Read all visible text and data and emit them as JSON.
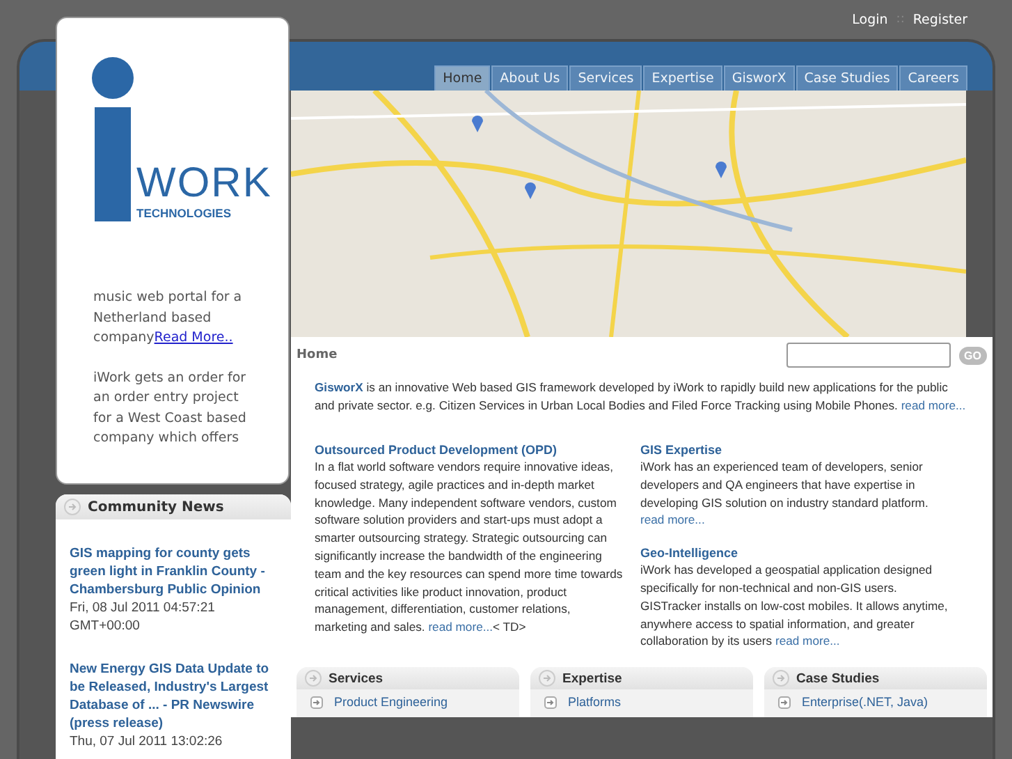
{
  "header_links": [
    {
      "label": "Login"
    },
    {
      "label": "Register"
    }
  ],
  "header_separator": "::",
  "logo": {
    "word": "WORK",
    "tagline": "TECHNOLOGIES"
  },
  "nav_tabs": [
    {
      "label": "Home",
      "selected": true
    },
    {
      "label": "About Us",
      "selected": false
    },
    {
      "label": "Services",
      "selected": false
    },
    {
      "label": "Expertise",
      "selected": false
    },
    {
      "label": "GisworX",
      "selected": false
    },
    {
      "label": "Case Studies",
      "selected": false
    },
    {
      "label": "Careers",
      "selected": false
    }
  ],
  "ticker": [
    {
      "text": "music web portal for a Netherland based company",
      "link": "Read More.."
    },
    {
      "text": "iWork gets an order for an order entry project for a West Coast based company which offers"
    }
  ],
  "community_news": {
    "title": "Community News",
    "items": [
      {
        "title": "GIS mapping for county gets green light in Franklin County - Chambersburg Public Opinion",
        "date": "Fri, 08 Jul 2011 04:57:21 GMT+00:00"
      },
      {
        "title": "New Energy GIS Data Update to be Released, Industry's Largest Database of ... - PR Newswire (press release)",
        "date": "Thu, 07 Jul 2011 13:02:26"
      }
    ]
  },
  "breadcrumb": "Home",
  "search": {
    "button": "GO"
  },
  "intro": {
    "link": "GisworX",
    "text": "is an innovative Web based GIS framework developed by iWork to rapidly build new applications for the public and private sector. e.g. Citizen Services in Urban Local Bodies and Filed Force Tracking using Mobile Phones.",
    "more": "read more..."
  },
  "sections": [
    {
      "title": "Outsourced Product Development (OPD)",
      "text": "In a flat world software vendors require innovative ideas, focused strategy, agile practices and in-depth market knowledge. Many independent software vendors, custom software solution providers and start-ups must adopt a smarter outsourcing strategy. Strategic outsourcing can significantly increase the bandwidth of the engineering team and the key resources can spend more time towards critical activities like product innovation, product management, differentiation, customer relations, marketing and sales.",
      "more": "read more...",
      "suffix": "< TD>"
    },
    {
      "title": "GIS Expertise",
      "text": "iWork has an experienced team of developers, senior developers and QA engineers that have expertise in developing GIS solution on industry standard platform.",
      "more": "read more..."
    },
    {
      "title": "Geo-Intelligence",
      "text": "iWork has developed a geospatial application designed specifically for non-technical and non-GIS users. GISTracker installs on low-cost mobiles. It allows anytime, anywhere access to spatial information, and greater collaboration by its users",
      "more": "read more..."
    }
  ],
  "boxes": [
    {
      "title": "Services",
      "items": [
        "Product Engineering"
      ]
    },
    {
      "title": "Expertise",
      "items": [
        "Platforms"
      ]
    },
    {
      "title": "Case Studies",
      "items": [
        "Enterprise(.NET, Java)"
      ]
    }
  ]
}
